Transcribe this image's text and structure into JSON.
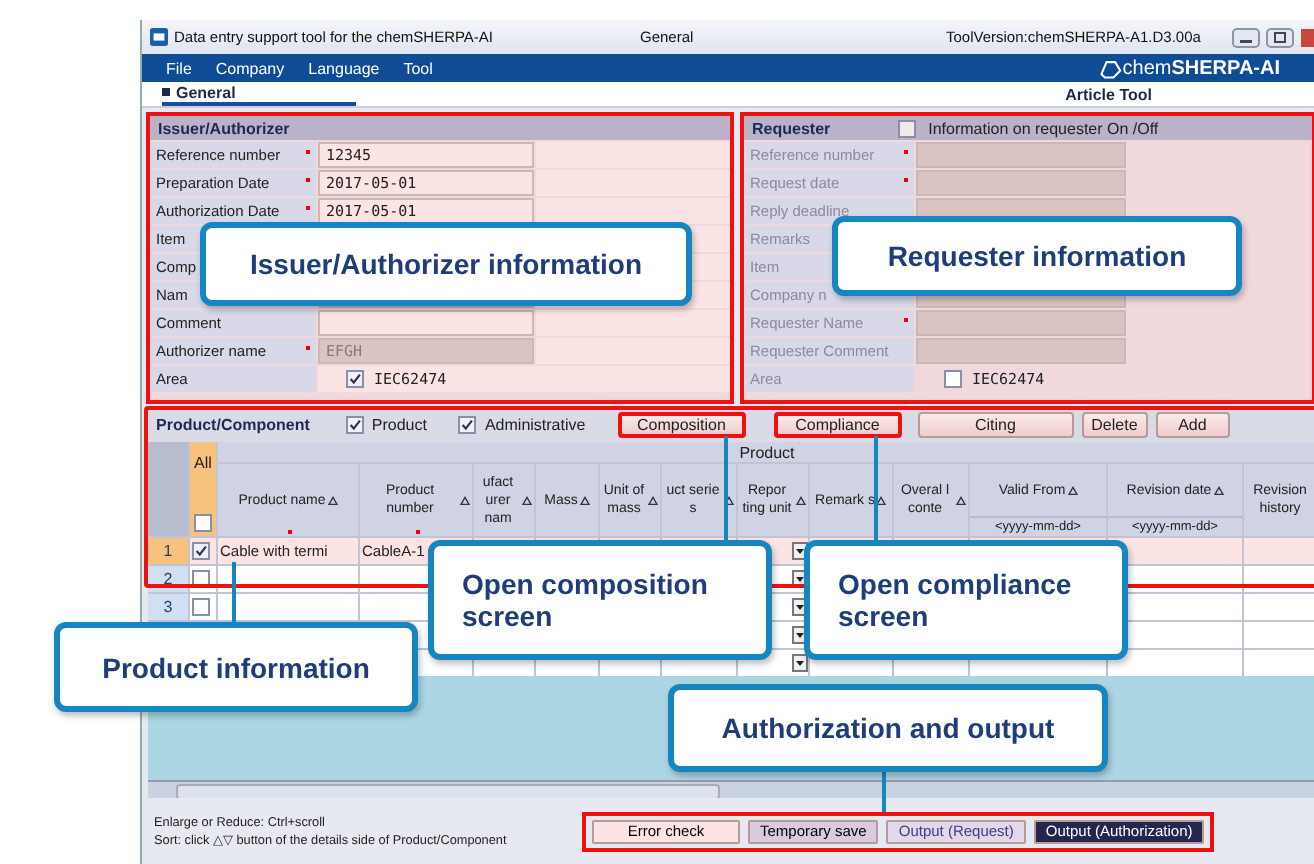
{
  "window": {
    "title": "Data entry support tool for the chemSHERPA-AI",
    "center_title": "General",
    "version": "ToolVersion:chemSHERPA-A1.D3.00a"
  },
  "menu": [
    "File",
    "Company",
    "Language",
    "Tool"
  ],
  "logo": "chem**SHERPA-AI**",
  "tab": {
    "label": "General",
    "selected": true
  },
  "subtitle": "Article Tool",
  "issuer": {
    "title": "Issuer/Authorizer",
    "fields": [
      {
        "kind": "text",
        "label": "Reference number",
        "required": true,
        "value": "12345"
      },
      {
        "kind": "text",
        "label": "Preparation Date",
        "required": true,
        "value": "2017-05-01"
      },
      {
        "kind": "text",
        "label": "Authorization Date",
        "required": true,
        "value": "2017-05-01"
      },
      {
        "kind": "text",
        "label": "Item"
      },
      {
        "kind": "text",
        "label": "Comp"
      },
      {
        "kind": "text",
        "label": "Nam"
      },
      {
        "kind": "text",
        "label": "Comment"
      },
      {
        "kind": "text",
        "label": "Authorizer name",
        "required": true,
        "value": "EFGH",
        "disabled": true
      },
      {
        "kind": "checkbox",
        "label": "Area",
        "checked": true,
        "text": "IEC62474"
      }
    ]
  },
  "requester": {
    "title": "Requester",
    "toggle": {
      "label": "Information on requester On /Off",
      "checked": false
    },
    "fields": [
      {
        "kind": "text",
        "label": "Reference number",
        "required": true
      },
      {
        "kind": "text",
        "label": "Request date",
        "required": true
      },
      {
        "kind": "text",
        "label": "Reply deadline"
      },
      {
        "kind": "text",
        "label": "Remarks"
      },
      {
        "kind": "text",
        "label": "Item"
      },
      {
        "kind": "text",
        "label": "Company n"
      },
      {
        "kind": "text",
        "label": "Requester Name",
        "required": true
      },
      {
        "kind": "text",
        "label": "Requester Comment"
      },
      {
        "kind": "checkbox",
        "label": "Area",
        "checked": false,
        "text": "IEC62474"
      }
    ]
  },
  "product": {
    "title": "Product/Component",
    "filters": [
      {
        "label": "Product",
        "checked": true
      },
      {
        "label": "Administrative",
        "checked": true
      }
    ],
    "buttons": [
      "Composition",
      "Compliance",
      "Citing",
      "Delete",
      "Add"
    ],
    "group_header": "Product",
    "all_label": "All",
    "all_checked": false,
    "columns": [
      {
        "label": "Product name",
        "required": true
      },
      {
        "label": "Product number",
        "required": true
      },
      {
        "label": "ufact urer nam"
      },
      {
        "label": "Mass"
      },
      {
        "label": "Unit of mass"
      },
      {
        "label": "uct serie s"
      },
      {
        "label": "Repor ting unit"
      },
      {
        "label": "Remark s"
      },
      {
        "label": "Overal l conte"
      },
      {
        "label": "Valid From",
        "sub": "<yyyy-mm-dd>"
      },
      {
        "label": "Revision date",
        "sub": "<yyyy-mm-dd>"
      },
      {
        "label": "Revision history",
        "nosort": true
      }
    ],
    "rows": [
      {
        "number": "1",
        "selected": true,
        "checked": true,
        "cells": [
          "Cable with termi",
          "CableA-1"
        ]
      },
      {
        "number": "2",
        "selected": false,
        "checked": false
      },
      {
        "number": "3",
        "selected": false,
        "checked": false
      }
    ]
  },
  "hints": [
    "Enlarge or Reduce: Ctrl+scroll",
    "Sort:  click △▽ button of the details side of Product/Component"
  ],
  "actions": [
    {
      "label": "Error check",
      "kind": "pink"
    },
    {
      "label": "Temporary save",
      "kind": "mauve"
    },
    {
      "label": "Output (Request)",
      "kind": "light"
    },
    {
      "label": "Output (Authorization)",
      "kind": "dark"
    }
  ],
  "callouts": [
    "Issuer/Authorizer information",
    "Requester information",
    "Open composition screen",
    "Open compliance screen",
    "Product information",
    "Authorization and output"
  ]
}
